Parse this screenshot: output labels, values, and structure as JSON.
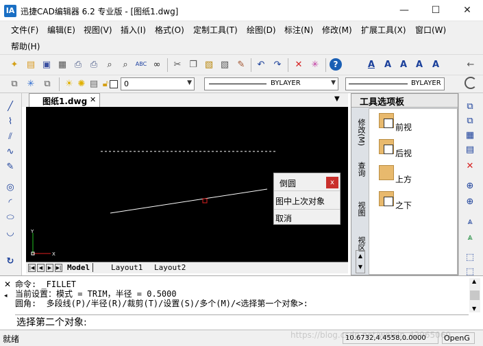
{
  "window": {
    "title": "迅捷CAD编辑器 6.2 专业版 - [图纸1.dwg]",
    "logo_text": "IA",
    "controls": [
      "minimize-icon",
      "maximize-icon",
      "close-icon"
    ]
  },
  "menu": {
    "items": [
      "文件(F)",
      "编辑(E)",
      "视图(V)",
      "插入(I)",
      "格式(O)",
      "定制工具(T)",
      "绘图(D)",
      "标注(N)",
      "修改(M)",
      "扩展工具(X)",
      "窗口(W)",
      "帮助(H)"
    ]
  },
  "toolbar2": {
    "layer_value": "0",
    "color_value": "BYLAYER",
    "linetype_value": "BYLAYER"
  },
  "document": {
    "tab_label": "图纸1.dwg",
    "tab_close": "✕"
  },
  "popup": {
    "title": "倒圆",
    "close": "x",
    "items": [
      "图中上次对象",
      "取消"
    ]
  },
  "layout_tabs": [
    "Model",
    "Layout1",
    "Layout2"
  ],
  "palette": {
    "title": "工具选项板",
    "vtabs": [
      "修改(M)",
      "查询",
      "视图",
      "视区"
    ],
    "items": [
      "前视",
      "后视",
      "上方",
      "之下"
    ]
  },
  "command": {
    "log": [
      "命令: _FILLET",
      "当前设置：模式 = TRIM，半径 = 0.5000",
      "圆角:  多段线(P)/半径(R)/裁剪(T)/设置(S)/多个(M)/<选择第一个对象>:"
    ],
    "prompt": "选择第二个对象:"
  },
  "status": {
    "ready": "就绪",
    "coords": "10.6732,4.4558,0.0000",
    "mode": "OpenG",
    "watermark": "https://blog.csdn.net/weixin_42965060"
  },
  "colors": {
    "canvas_bg": "#000000",
    "accent_blue": "#1a6fc4",
    "palette_box": "#e8b96d",
    "close_red": "#c9302c"
  }
}
